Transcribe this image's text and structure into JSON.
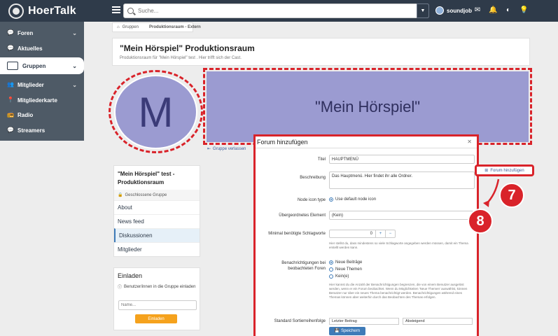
{
  "app": {
    "name": "HoerTalk"
  },
  "search": {
    "placeholder": "Suche..."
  },
  "user": {
    "name": "soundjob"
  },
  "sidebar": {
    "items": [
      {
        "label": "Foren"
      },
      {
        "label": "Aktuelles"
      },
      {
        "label": "Gruppen"
      },
      {
        "label": "Mitglieder"
      },
      {
        "label": "Mitgliederkarte"
      },
      {
        "label": "Radio"
      },
      {
        "label": "Streamers"
      }
    ]
  },
  "breadcrumb": {
    "items": [
      "Gruppen",
      "Produktionsraum - Extern"
    ]
  },
  "page": {
    "title": "\"Mein Hörspiel\" Produktionsraum",
    "subtitle": "Produktionsraum für \"Mein Hörspiel\" test . Hier trifft sich der Cast.",
    "avatar_letter": "M",
    "banner_text": "\"Mein Hörspiel\"",
    "leave_label": "Gruppe verlassen"
  },
  "group_card": {
    "title": "\"Mein Hörspiel\" test - Produktionsraum",
    "type": "Geschlossene Gruppe",
    "links": [
      "About",
      "News feed",
      "Diskussionen",
      "Mitglieder"
    ]
  },
  "invite": {
    "title": "Einladen",
    "hint": "Benutzer/innen in die Gruppe einladen",
    "placeholder": "Name...",
    "button": "Einladen"
  },
  "modal": {
    "title": "Forum hinzufügen",
    "fields": {
      "title_label": "Titel",
      "title_value": "HAUPTMENÜ",
      "desc_label": "Beschreibung",
      "desc_value": "Das Hauptmenü. Hier findet ihr alle Ordner.",
      "node_label": "Node icon type",
      "node_option": "Use default node icon",
      "parent_label": "Übergeordnetes Element",
      "parent_value": "(Kein)",
      "minwords_label": "Minimal benötigte Schlagworte",
      "minwords_value": "0",
      "minwords_explain": "Hier stellst du, dass mindestens so viele Schlagworte angegeben werden müssen, damit ein Thema erstellt werden kann.",
      "notify_label": "Benachrichtigungen bei beobachteten Foren",
      "notify_options": [
        "Neue Beiträge",
        "Neue Themen",
        "Kein(e)"
      ],
      "notify_explain": "Hier kannst du die Anzahl der Benachrichtigungen begrenzen, die von einem Benutzer ausgelöst werden, wenn er ein Forum beobachtet. Wenn du Möglichkeiten 'Neue Themen' auswählst, können Benutzer nur über ein neues Thema benachrichtigt werden. Benachrichtigungen während eines Themas können aber weiterhin durch das Beobachten des Themas erfolgen.",
      "sort_label": "Standard Sortierreihenfolge",
      "sort_value": "Letzter Beitrag",
      "sort_dir": "Absteigend"
    },
    "save": "Speichern"
  },
  "annotations": {
    "add_forum": "Forum hinzufügen",
    "step_7": "7",
    "step_8": "8"
  }
}
